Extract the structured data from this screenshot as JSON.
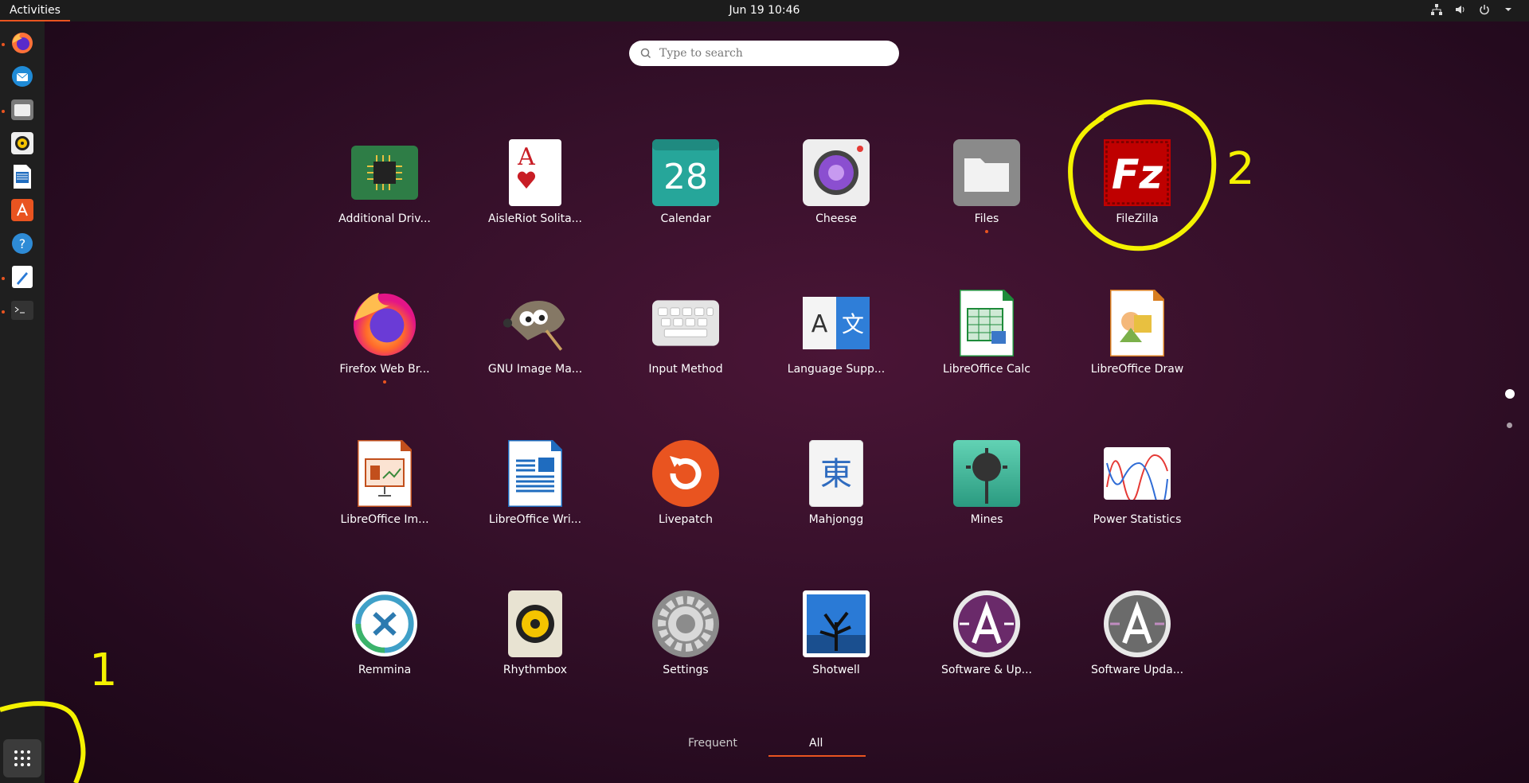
{
  "topbar": {
    "activities": "Activities",
    "clock": "Jun 19  10:46"
  },
  "search": {
    "placeholder": "Type to search"
  },
  "apps": [
    {
      "label": "Additional Driv...",
      "icon": "chip-icon"
    },
    {
      "label": "AisleRiot Solita...",
      "icon": "playing-card-icon"
    },
    {
      "label": "Calendar",
      "icon": "calendar-icon",
      "day": "28"
    },
    {
      "label": "Cheese",
      "icon": "camera-icon"
    },
    {
      "label": "Files",
      "icon": "folder-icon"
    },
    {
      "label": "FileZilla",
      "icon": "filezilla-icon",
      "glyph": "Fz"
    },
    {
      "label": "Firefox Web Br...",
      "icon": "firefox-icon"
    },
    {
      "label": "GNU Image Ma...",
      "icon": "gimp-icon"
    },
    {
      "label": "Input Method",
      "icon": "keyboard-icon"
    },
    {
      "label": "Language Supp...",
      "icon": "language-icon",
      "glyph_a": "A",
      "glyph_b": "文"
    },
    {
      "label": "LibreOffice Calc",
      "icon": "spreadsheet-icon"
    },
    {
      "label": "LibreOffice Draw",
      "icon": "drawing-icon"
    },
    {
      "label": "LibreOffice Im...",
      "icon": "presentation-icon"
    },
    {
      "label": "LibreOffice Wri...",
      "icon": "writer-document-icon"
    },
    {
      "label": "Livepatch",
      "icon": "livepatch-icon"
    },
    {
      "label": "Mahjongg",
      "icon": "mahjongg-tile-icon",
      "glyph": "東"
    },
    {
      "label": "Mines",
      "icon": "mine-icon"
    },
    {
      "label": "Power Statistics",
      "icon": "power-graph-icon"
    },
    {
      "label": "Remmina",
      "icon": "remmina-icon"
    },
    {
      "label": "Rhythmbox",
      "icon": "speaker-icon"
    },
    {
      "label": "Settings",
      "icon": "settings-gear-icon"
    },
    {
      "label": "Shotwell",
      "icon": "shotwell-tree-icon"
    },
    {
      "label": "Software & Up...",
      "icon": "software-properties-icon"
    },
    {
      "label": "Software Upda...",
      "icon": "software-updater-icon"
    }
  ],
  "tabs": {
    "frequent": "Frequent",
    "all": "All"
  },
  "annotations": {
    "one": "1",
    "two": "2"
  },
  "colors": {
    "accent": "#e95420",
    "annotation": "#f4f200"
  }
}
